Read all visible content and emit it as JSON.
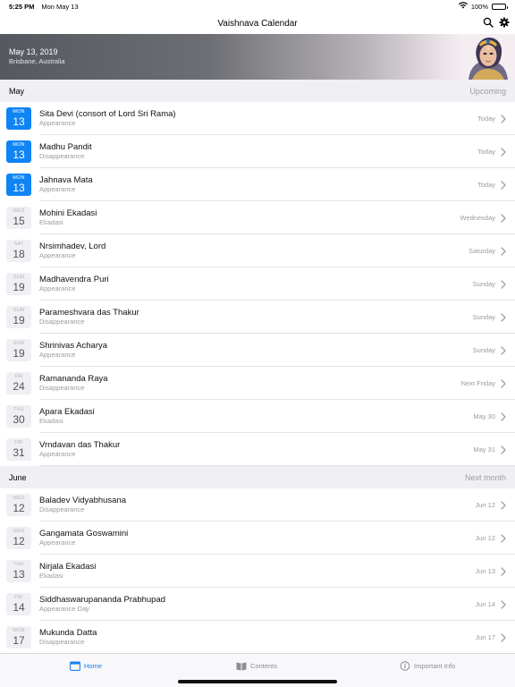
{
  "status_bar": {
    "time": "5:25 PM",
    "date": "Mon May 13",
    "battery": "100%",
    "battery_level": 1.0
  },
  "nav": {
    "title": "Vaishnava Calendar"
  },
  "hero": {
    "date": "May 13, 2019",
    "location": "Brisbane, Australia"
  },
  "sections": [
    {
      "month": "May",
      "tag": "Upcoming",
      "events": [
        {
          "dow": "MON",
          "day": "13",
          "name": "Sita Devi (consort of Lord Sri Rama)",
          "kind": "Appearance",
          "when": "Today",
          "today": true
        },
        {
          "dow": "MON",
          "day": "13",
          "name": "Madhu Pandit",
          "kind": "Disappearance",
          "when": "Today",
          "today": true
        },
        {
          "dow": "MON",
          "day": "13",
          "name": "Jahnava Mata",
          "kind": "Appearance",
          "when": "Today",
          "today": true
        },
        {
          "dow": "WED",
          "day": "15",
          "name": "Mohini Ekadasi",
          "kind": "Ekadasi",
          "when": "Wednesday",
          "today": false
        },
        {
          "dow": "SAT",
          "day": "18",
          "name": "Nrsimhadev, Lord",
          "kind": "Appearance",
          "when": "Saturday",
          "today": false
        },
        {
          "dow": "SUN",
          "day": "19",
          "name": "Madhavendra Puri",
          "kind": "Appearance",
          "when": "Sunday",
          "today": false
        },
        {
          "dow": "SUN",
          "day": "19",
          "name": "Parameshvara das Thakur",
          "kind": "Disappearance",
          "when": "Sunday",
          "today": false
        },
        {
          "dow": "SUN",
          "day": "19",
          "name": "Shrinivas Acharya",
          "kind": "Appearance",
          "when": "Sunday",
          "today": false
        },
        {
          "dow": "FRI",
          "day": "24",
          "name": "Ramananda Raya",
          "kind": "Disappearance",
          "when": "Next Friday",
          "today": false
        },
        {
          "dow": "THU",
          "day": "30",
          "name": "Apara Ekadasi",
          "kind": "Ekadasi",
          "when": "May 30",
          "today": false
        },
        {
          "dow": "FRI",
          "day": "31",
          "name": "Vrndavan das Thakur",
          "kind": "Appearance",
          "when": "May 31",
          "today": false
        }
      ]
    },
    {
      "month": "June",
      "tag": "Next month",
      "events": [
        {
          "dow": "WED",
          "day": "12",
          "name": "Baladev Vidyabhusana",
          "kind": "Disappearance",
          "when": "Jun 12",
          "today": false
        },
        {
          "dow": "WED",
          "day": "12",
          "name": "Gangamata Goswamini",
          "kind": "Appearance",
          "when": "Jun 12",
          "today": false
        },
        {
          "dow": "THU",
          "day": "13",
          "name": "Nirjala Ekadasi",
          "kind": "Ekadasi",
          "when": "Jun 13",
          "today": false
        },
        {
          "dow": "FRI",
          "day": "14",
          "name": "Siddhaswarupananda Prabhupad",
          "kind": "Appearance Day",
          "when": "Jun 14",
          "today": false
        },
        {
          "dow": "MON",
          "day": "17",
          "name": "Mukunda Datta",
          "kind": "Disappearance",
          "when": "Jun 17",
          "today": false
        }
      ]
    }
  ],
  "tabs": [
    {
      "label": "Home",
      "icon": "calendar-icon",
      "active": true
    },
    {
      "label": "Contents",
      "icon": "book-icon",
      "active": false
    },
    {
      "label": "Important Info",
      "icon": "info-icon",
      "active": false
    }
  ],
  "colors": {
    "accent": "#0f84f5",
    "section_bg": "#efeff4",
    "secondary_text": "#9b9ba1"
  }
}
